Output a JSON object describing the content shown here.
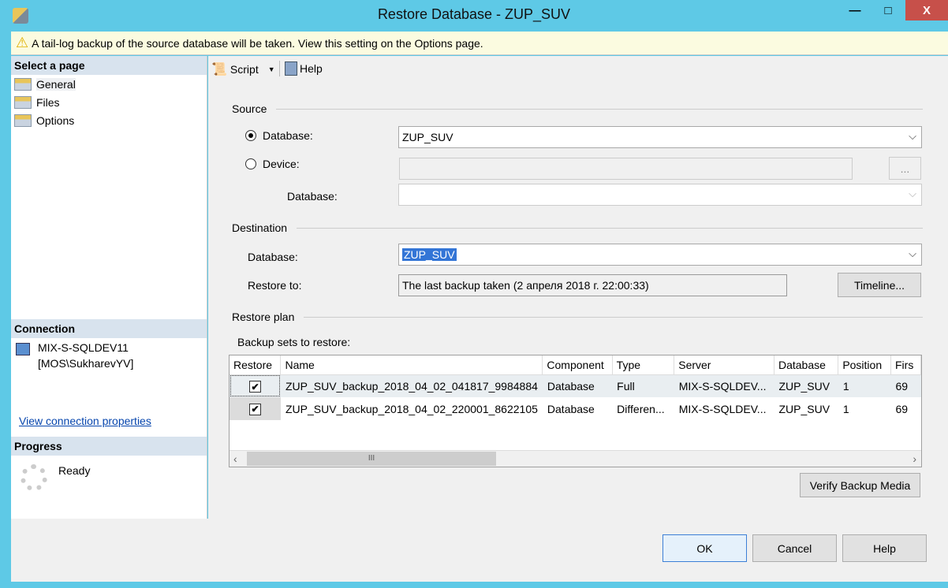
{
  "window": {
    "title": "Restore Database - ZUP_SUV",
    "minimize": "—",
    "maximize": "□",
    "close": "X"
  },
  "warning": "A tail-log backup of the source database will be taken. View this setting on the Options page.",
  "sidebar": {
    "select_page": "Select a page",
    "pages": [
      {
        "label": "General"
      },
      {
        "label": "Files"
      },
      {
        "label": "Options"
      }
    ],
    "connection_header": "Connection",
    "server": "MIX-S-SQLDEV11",
    "user": "[MOS\\SukharevYV]",
    "view_connection": "View connection properties",
    "progress_header": "Progress",
    "progress_status": "Ready"
  },
  "toolbar": {
    "script": "Script",
    "help": "Help"
  },
  "source": {
    "label": "Source",
    "database_radio": "Database:",
    "database_value": "ZUP_SUV",
    "device_radio": "Device:",
    "device_value": "",
    "device_browse": "...",
    "device_database_label": "Database:",
    "device_database_value": ""
  },
  "destination": {
    "label": "Destination",
    "database_label": "Database:",
    "database_value": "ZUP_SUV",
    "restore_to_label": "Restore to:",
    "restore_to_value": "The last backup taken (2 апреля 2018 г. 22:00:33)",
    "timeline": "Timeline..."
  },
  "plan": {
    "label": "Restore plan",
    "backup_sets_label": "Backup sets to restore:",
    "columns": [
      "Restore",
      "Name",
      "Component",
      "Type",
      "Server",
      "Database",
      "Position",
      "Firs"
    ],
    "rows": [
      {
        "restore": true,
        "name": "ZUP_SUV_backup_2018_04_02_041817_9984884",
        "component": "Database",
        "type": "Full",
        "server": "MIX-S-SQLDEV...",
        "database": "ZUP_SUV",
        "position": "1",
        "first": "69"
      },
      {
        "restore": true,
        "name": "ZUP_SUV_backup_2018_04_02_220001_8622105",
        "component": "Database",
        "type": "Differen...",
        "server": "MIX-S-SQLDEV...",
        "database": "ZUP_SUV",
        "position": "1",
        "first": "69"
      }
    ],
    "verify": "Verify Backup Media"
  },
  "buttons": {
    "ok": "OK",
    "cancel": "Cancel",
    "help": "Help"
  }
}
